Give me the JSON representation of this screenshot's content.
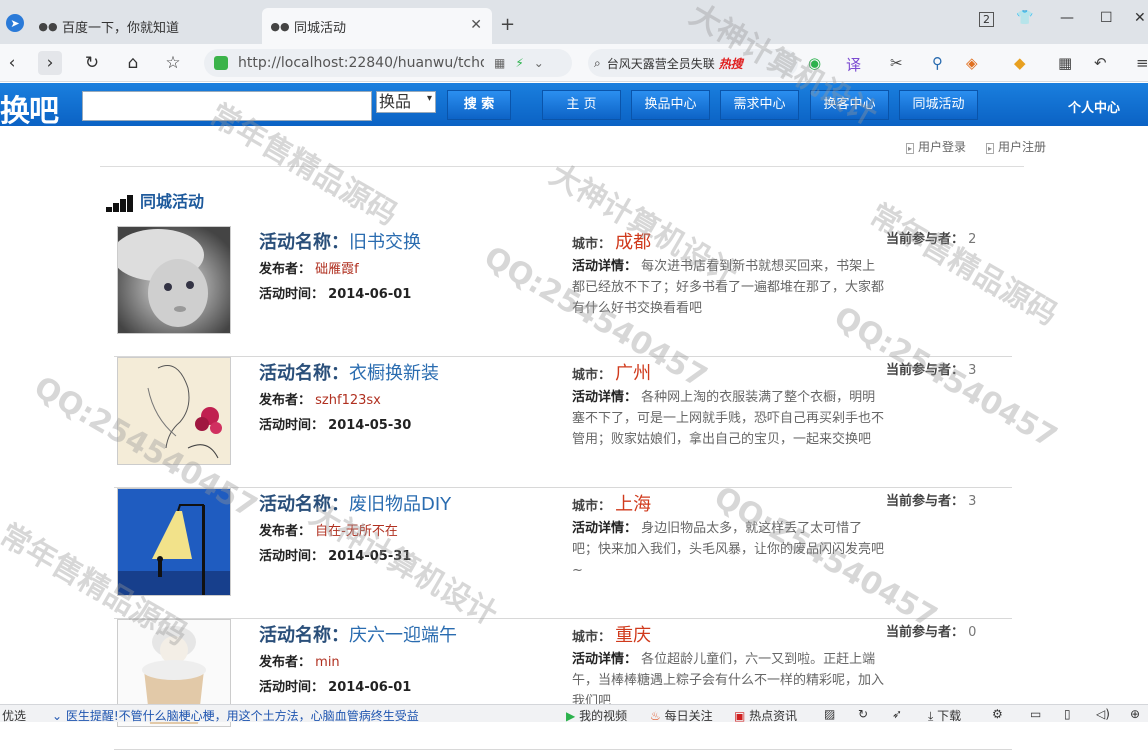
{
  "browser": {
    "tabs": [
      {
        "title": "百度一下，你就知道",
        "active": false
      },
      {
        "title": "同城活动",
        "active": true
      }
    ],
    "new_tab": "+",
    "tab_count": "2",
    "url": "http://localhost:22840/huanwu/tchd",
    "search_hint": "台风天露营全员失联",
    "search_hot": "热搜"
  },
  "site": {
    "logo": "换吧",
    "search_placeholder": "",
    "search_type": "换品",
    "search_button": "搜 索",
    "nav": [
      "主 页",
      "换品中心",
      "需求中心",
      "换客中心",
      "同城活动"
    ],
    "user_center": "个人中心",
    "login": "用户登录",
    "register": "用户注册",
    "section_title": "同城活动"
  },
  "labels": {
    "name": "活动名称：",
    "publisher": "发布者：",
    "time": "活动时间：",
    "city": "城市：",
    "detail": "活动详情：",
    "count": "当前参与者："
  },
  "activities": [
    {
      "name": "旧书交换",
      "publisher": "础雁霞f",
      "time": "2014-06-01",
      "city": "成都",
      "detail": "每次进书店看到新书就想买回来，书架上都已经放不下了；好多书看了一遍都堆在那了，大家都有什么好书交换看看吧",
      "count": "2",
      "thumb": "girl-portrait"
    },
    {
      "name": "衣橱换新装",
      "publisher": "szhf123sx",
      "time": "2014-05-30",
      "city": "广州",
      "detail": "各种网上淘的衣服装满了整个衣橱，明明塞不下了，可是一上网就手贱，恐吓自己再买剁手也不管用；败家姑娘们，拿出自己的宝贝，一起来交换吧",
      "count": "3",
      "thumb": "fashion-sketch"
    },
    {
      "name": "废旧物品DIY",
      "publisher": "自在-无所不在",
      "time": "2014-05-31",
      "city": "上海",
      "detail": "身边旧物品太多，就这样丢了太可惜了吧；快来加入我们，头毛风暴，让你的废品闪闪发亮吧~",
      "count": "3",
      "thumb": "streetlamp-blue"
    },
    {
      "name": "庆六一迎端午",
      "publisher": "min",
      "time": "2014-06-01",
      "city": "重庆",
      "detail": "各位超龄儿童们，六一又到啦。正赶上端午，当棒棒糖遇上粽子会有什么不一样的精彩呢，加入我们吧",
      "count": "0",
      "thumb": "cupcake-doll"
    }
  ],
  "statusbar": {
    "left": "优选",
    "news": "医生提醒!不管什么脑梗心梗，用这个土方法，心脑血管病终生受益",
    "video": "我的视频",
    "follow": "每日关注",
    "hotnews": "热点资讯",
    "download": "下载"
  },
  "watermarks": [
    "常年售精品源码",
    "大神计算机设计",
    "QQ:254540457"
  ]
}
